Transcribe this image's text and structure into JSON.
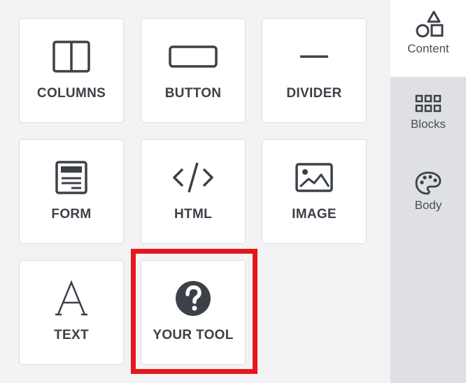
{
  "tools": [
    {
      "label": "COLUMNS",
      "icon": "columns-icon"
    },
    {
      "label": "BUTTON",
      "icon": "button-icon"
    },
    {
      "label": "DIVIDER",
      "icon": "divider-icon"
    },
    {
      "label": "FORM",
      "icon": "form-icon"
    },
    {
      "label": "HTML",
      "icon": "html-code-icon"
    },
    {
      "label": "IMAGE",
      "icon": "image-icon"
    },
    {
      "label": "TEXT",
      "icon": "text-icon"
    },
    {
      "label": "YOUR TOOL",
      "icon": "question-icon"
    }
  ],
  "sidebar": {
    "tabs": [
      {
        "label": "Content",
        "icon": "shapes-icon",
        "active": true
      },
      {
        "label": "Blocks",
        "icon": "grid-icon",
        "active": false
      },
      {
        "label": "Body",
        "icon": "palette-icon",
        "active": false
      }
    ]
  },
  "colors": {
    "highlight": "#e5171c",
    "icon": "#3c4148",
    "sidebar_bg": "#dfe0e3",
    "panel_bg": "#f3f3f5"
  }
}
